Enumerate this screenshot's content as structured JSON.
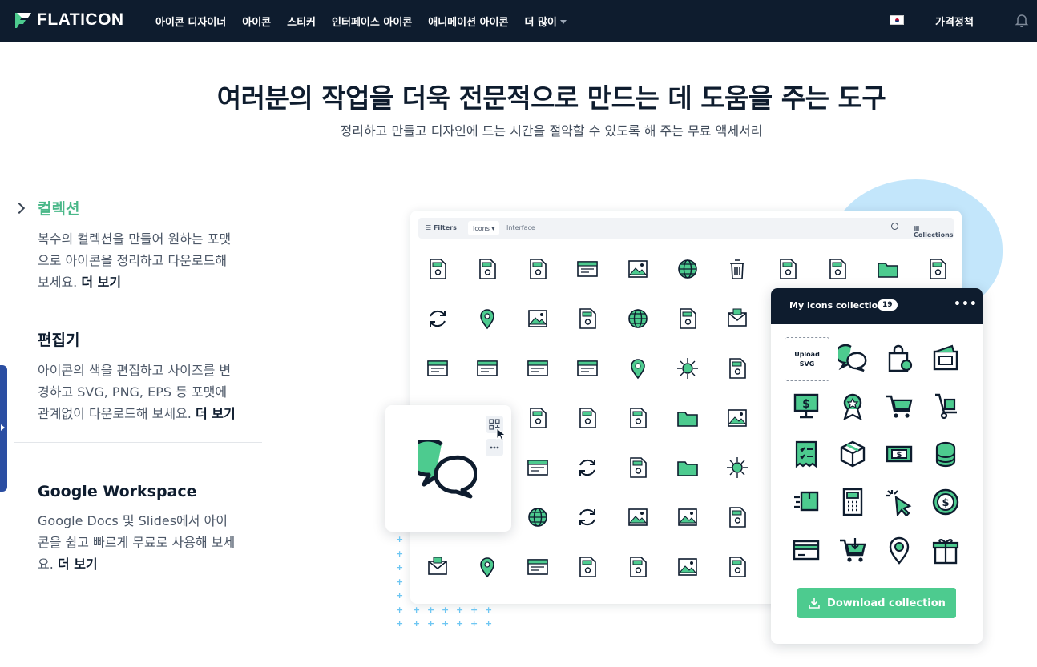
{
  "nav": {
    "logo_text": "FLATICON",
    "links": [
      "아이콘 디자이너",
      "아이콘",
      "스티커",
      "인터페이스 아이콘",
      "애니메이션 아이콘",
      "더 많이"
    ],
    "pricing": "가격정책"
  },
  "hero": {
    "title": "여러분의 작업을 더욱 전문적으로 만드는 데 도움을 주는 도구",
    "subtitle": "정리하고 만들고 디자인에 드는 시간을 절약할 수 있도록 해 주는 무료 액세서리"
  },
  "features": [
    {
      "title": "컬렉션",
      "body": "복수의 컬렉션을 만들어 원하는 포맷으로 아이콘을 정리하고 다운로드해 보세요.",
      "more": "더 보기"
    },
    {
      "title": "편집기",
      "body": "아이콘의 색을 편집하고 사이즈를 변경하고 SVG, PNG, EPS 등 포맷에 관계없이 다운로드해 보세요.",
      "more": "더 보기"
    },
    {
      "title": "Google Workspace",
      "body": "Google Docs 및 Slides에서 아이콘을 쉽고 빠르게 무료로 사용해 보세요.",
      "more": "더 보기"
    }
  ],
  "board": {
    "filters_label": "Filters",
    "icons_select": "Icons",
    "search_value": "Interface",
    "collections_label": "Collections"
  },
  "collection": {
    "title": "My icons collection",
    "count": "19",
    "upload_line1": "Upload",
    "upload_line2": "SVG",
    "download_label": "Download collection"
  },
  "colors": {
    "navy": "#0e1c2e",
    "green": "#4dcb8f",
    "light_blue": "#c3e6fb"
  }
}
